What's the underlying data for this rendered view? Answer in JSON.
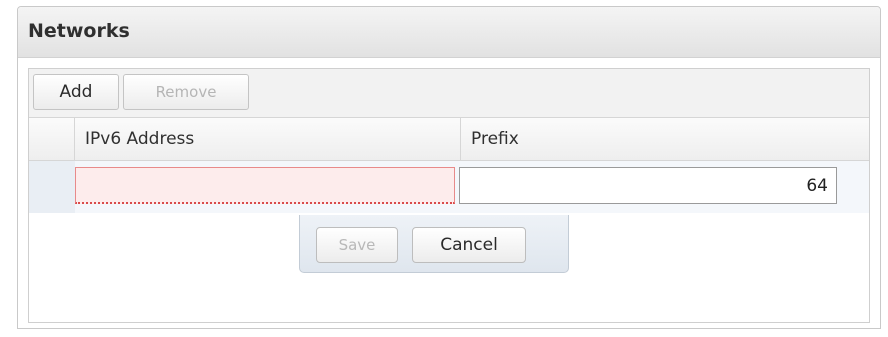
{
  "panel": {
    "title": "Networks"
  },
  "toolbar": {
    "add_label": "Add",
    "remove_label": "Remove"
  },
  "grid": {
    "columns": [
      "IPv6 Address",
      "Prefix"
    ],
    "editor": {
      "ipv6_value": "",
      "prefix_value": "64"
    }
  },
  "editor_buttons": {
    "save_label": "Save",
    "cancel_label": "Cancel"
  }
}
